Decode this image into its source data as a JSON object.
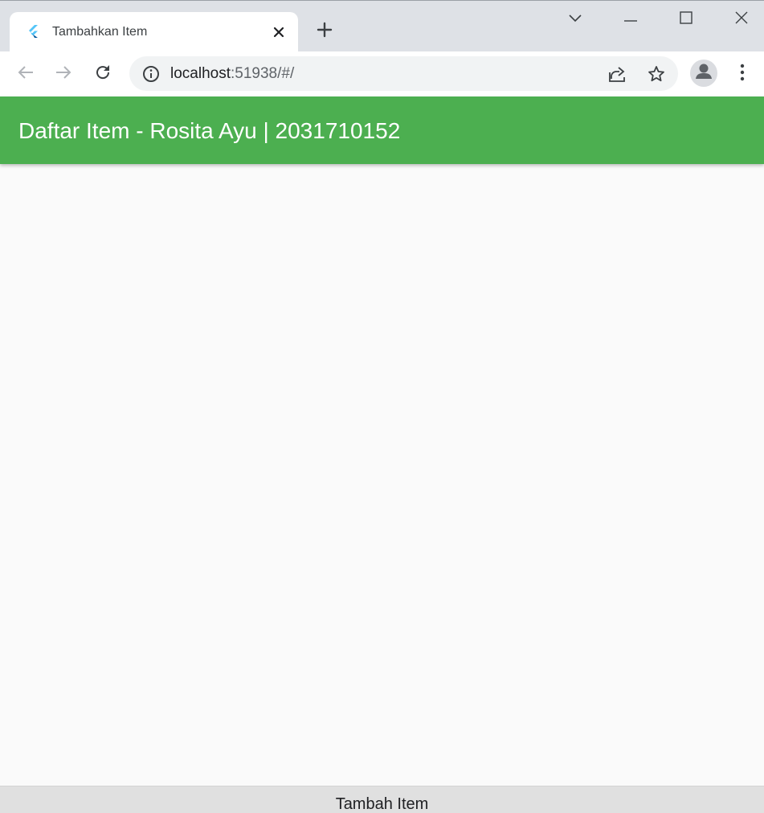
{
  "browser": {
    "tab": {
      "title": "Tambahkan Item"
    },
    "address_bar": {
      "host": "localhost",
      "path": ":51938/#/"
    }
  },
  "app": {
    "title": "Daftar Item - Rosita Ayu | 2031710152",
    "primary_color": "#4caf50",
    "bottom_button_label": "Tambah Item"
  },
  "icons": {
    "favicon": "flutter-logo-icon",
    "tab_close": "close-icon",
    "new_tab": "plus-icon",
    "tab_search": "chevron-down-icon",
    "minimize": "minimize-icon",
    "maximize": "maximize-icon",
    "window_close": "close-icon",
    "back": "arrow-left-icon",
    "forward": "arrow-right-icon",
    "reload": "reload-icon",
    "site_info": "info-icon",
    "share": "share-icon",
    "bookmark": "star-icon",
    "profile": "person-icon",
    "menu": "more-vert-icon"
  }
}
